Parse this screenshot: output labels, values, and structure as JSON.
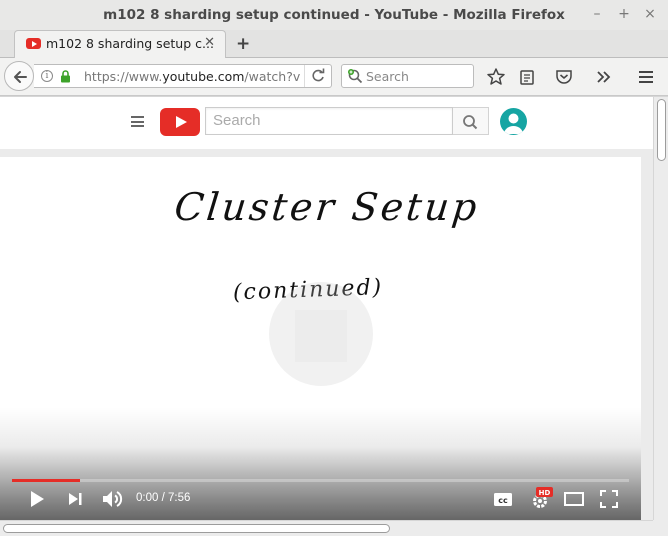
{
  "window": {
    "title": "m102 8 sharding setup continued - YouTube - Mozilla Firefox",
    "controls": {
      "minimize": "–",
      "maximize": "+",
      "close": "×"
    }
  },
  "tabs": [
    {
      "label": "m102 8 sharding setup c...",
      "favicon": "youtube-icon",
      "active": true
    }
  ],
  "newtab_label": "+",
  "navbar": {
    "url_prefix": "https://www.",
    "url_domain": "youtube.com",
    "url_suffix": "/watch?v",
    "search_placeholder": "Search",
    "icons": [
      "back-icon",
      "info-icon",
      "lock-icon",
      "reload-icon",
      "bookmark-star-icon",
      "reading-list-icon",
      "pocket-icon",
      "overflow-icon",
      "menu-icon"
    ]
  },
  "youtube": {
    "search_placeholder": "Search",
    "brand_color": "#e52d27",
    "avatar_color": "#16a5a3"
  },
  "video": {
    "slide_title": "Cluster Setup",
    "slide_subtitle": "(continued)",
    "time_current": "0:00",
    "time_separator": " / ",
    "time_total": "7:56",
    "progress": 0.11,
    "hd_badge": "HD",
    "controls": [
      "play-icon",
      "next-icon",
      "volume-icon",
      "captions-icon",
      "settings-icon",
      "theater-icon",
      "fullscreen-icon"
    ]
  }
}
